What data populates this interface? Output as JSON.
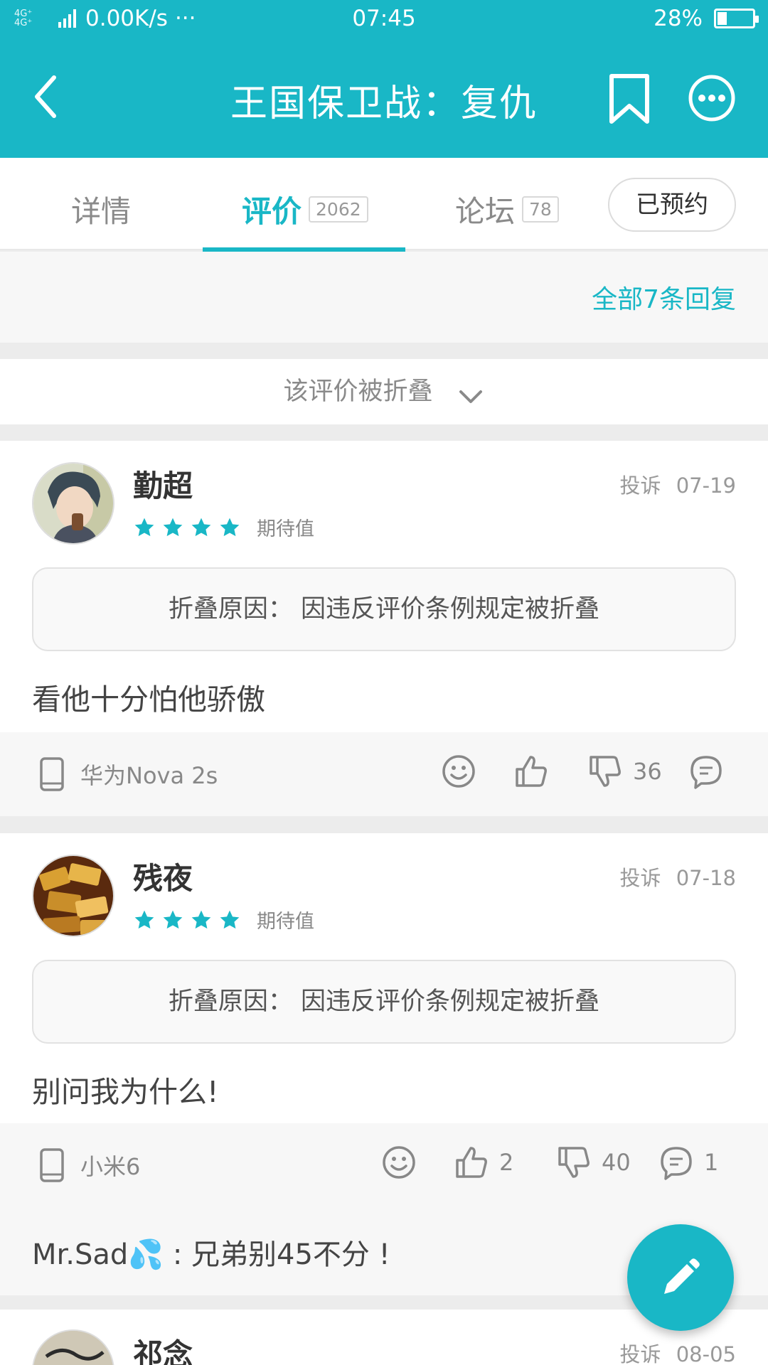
{
  "status_bar": {
    "network_left": "4G⁺ 4G⁺",
    "speed": "0.00K/s",
    "dots": "···",
    "time": "07:45",
    "battery_pct": "28%",
    "battery_level": 0.28
  },
  "header": {
    "title": "王国保卫战：复仇"
  },
  "tabs": {
    "details": "详情",
    "reviews": "评价",
    "reviews_count": "2062",
    "forum": "论坛",
    "forum_count": "78",
    "reserved": "已预约"
  },
  "reply_strip": {
    "all_replies": "全部7条回复"
  },
  "folded_bar": {
    "label": "该评价被折叠"
  },
  "reviews": [
    {
      "user": "勤超",
      "rating": 4,
      "expect_label": "期待值",
      "report": "投诉",
      "date": "07-19",
      "fold_reason": "折叠原因：  因违反评价条例规定被折叠",
      "content": "看他十分怕他骄傲",
      "device": "华为Nova 2s",
      "likes": "",
      "dislikes": "36",
      "comments": ""
    },
    {
      "user": "残夜",
      "rating": 4,
      "expect_label": "期待值",
      "report": "投诉",
      "date": "07-18",
      "fold_reason": "折叠原因：  因违反评价条例规定被折叠",
      "content": "别问我为什么!",
      "device": "小米6",
      "likes": "2",
      "dislikes": "40",
      "comments": "1",
      "reply": "Mr.Sad💦 : 兄弟别45不分 !"
    },
    {
      "user": "祁念",
      "report": "投诉",
      "date": "08-05"
    }
  ],
  "colors": {
    "accent": "#19b7c6"
  },
  "icons": [
    "back-arrow-icon",
    "bookmark-icon",
    "more-icon",
    "chevron-down-icon",
    "star-icon",
    "phone-icon",
    "emoji-icon",
    "thumbs-up-icon",
    "thumbs-down-icon",
    "comment-icon",
    "pencil-icon"
  ]
}
